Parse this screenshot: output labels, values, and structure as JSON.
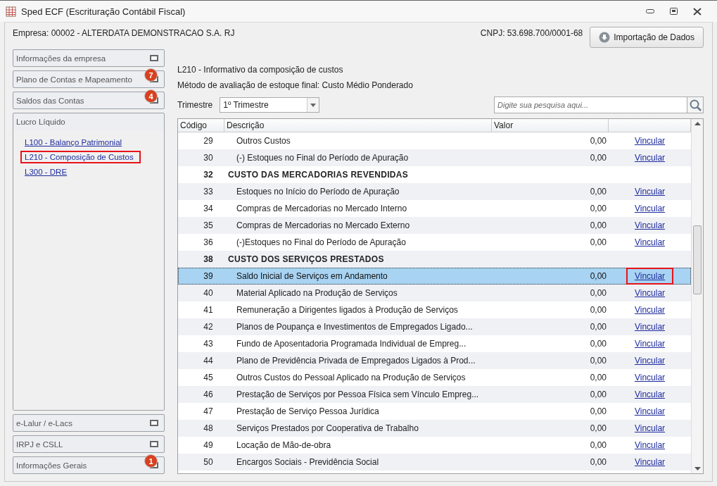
{
  "window": {
    "title": "Sped ECF (Escrituração Contábil Fiscal)"
  },
  "company": "Empresa: 00002 - ALTERDATA DEMONSTRACAO S.A. RJ",
  "cnpj": "CNPJ: 53.698.700/0001-68",
  "import_button": "Importação de Dados",
  "sidebar": {
    "top": [
      {
        "label": "Informações da empresa"
      },
      {
        "label": "Plano de Contas e Mapeamento",
        "badge": "7"
      },
      {
        "label": "Saldos das Contas",
        "badge": "4"
      }
    ],
    "open_section": {
      "label": "Lucro Líquido",
      "links": [
        {
          "label": "L100 - Balanço Patrimonial",
          "highlighted": false
        },
        {
          "label": "L210 - Composição de Custos",
          "highlighted": true
        },
        {
          "label": "L300 - DRE",
          "highlighted": false
        }
      ]
    },
    "bottom": [
      {
        "label": "e-Lalur / e-Lacs"
      },
      {
        "label": "IRPJ e CSLL"
      },
      {
        "label": "Informações Gerais",
        "badge": "1"
      }
    ]
  },
  "heading": "L210 - Informativo da composição de custos",
  "method": "Método de avaliação de estoque final: Custo Médio Ponderado",
  "trimestre": {
    "label": "Trimestre",
    "value": "1º Trimestre"
  },
  "search": {
    "placeholder": "Digite sua pesquisa aqui..."
  },
  "table": {
    "columns": [
      "Código",
      "Descrição",
      "Valor"
    ],
    "rows": [
      {
        "kind": "item",
        "code": "29",
        "description": "Outros Custos",
        "value": "0,00",
        "action": "Vincular",
        "selected": false,
        "highlighted": false
      },
      {
        "kind": "item",
        "code": "30",
        "description": "(-) Estoques no Final do Período de Apuração",
        "value": "0,00",
        "action": "Vincular",
        "selected": false,
        "highlighted": false
      },
      {
        "kind": "group",
        "code": "32",
        "description": "CUSTO DAS MERCADORIAS REVENDIDAS",
        "selected": false
      },
      {
        "kind": "item",
        "code": "33",
        "description": "Estoques no Início do Período de Apuração",
        "value": "0,00",
        "action": "Vincular",
        "selected": false,
        "highlighted": false
      },
      {
        "kind": "item",
        "code": "34",
        "description": "Compras de Mercadorias no Mercado Interno",
        "value": "0,00",
        "action": "Vincular",
        "selected": false,
        "highlighted": false
      },
      {
        "kind": "item",
        "code": "35",
        "description": "Compras de Mercadorias no Mercado Externo",
        "value": "0,00",
        "action": "Vincular",
        "selected": false,
        "highlighted": false
      },
      {
        "kind": "item",
        "code": "36",
        "description": "(-)Estoques no Final do Período de Apuração",
        "value": "0,00",
        "action": "Vincular",
        "selected": false,
        "highlighted": false
      },
      {
        "kind": "group",
        "code": "38",
        "description": "CUSTO DOS SERVIÇOS PRESTADOS",
        "selected": false
      },
      {
        "kind": "item",
        "code": "39",
        "description": "Saldo Inicial de Serviços em Andamento",
        "value": "0,00",
        "action": "Vincular",
        "selected": true,
        "highlighted": true
      },
      {
        "kind": "item",
        "code": "40",
        "description": "Material Aplicado na Produção de Serviços",
        "value": "0,00",
        "action": "Vincular",
        "selected": false,
        "highlighted": false
      },
      {
        "kind": "item",
        "code": "41",
        "description": "Remuneração a Dirigentes ligados à Produção de Serviços",
        "value": "0,00",
        "action": "Vincular",
        "selected": false,
        "highlighted": false
      },
      {
        "kind": "item",
        "code": "42",
        "description": "Planos de Poupança e Investimentos de Empregados Ligado...",
        "value": "0,00",
        "action": "Vincular",
        "selected": false,
        "highlighted": false
      },
      {
        "kind": "item",
        "code": "43",
        "description": "Fundo de Aposentadoria Programada Individual de Empreg...",
        "value": "0,00",
        "action": "Vincular",
        "selected": false,
        "highlighted": false
      },
      {
        "kind": "item",
        "code": "44",
        "description": "Plano de Previdência Privada de Empregados Ligados à Prod...",
        "value": "0,00",
        "action": "Vincular",
        "selected": false,
        "highlighted": false
      },
      {
        "kind": "item",
        "code": "45",
        "description": "Outros Custos do Pessoal Aplicado na Produção de Serviços",
        "value": "0,00",
        "action": "Vincular",
        "selected": false,
        "highlighted": false
      },
      {
        "kind": "item",
        "code": "46",
        "description": "Prestação de Serviços por Pessoa Física sem Vínculo Empreg...",
        "value": "0,00",
        "action": "Vincular",
        "selected": false,
        "highlighted": false
      },
      {
        "kind": "item",
        "code": "47",
        "description": "Prestação de Serviço Pessoa Jurídica",
        "value": "0,00",
        "action": "Vincular",
        "selected": false,
        "highlighted": false
      },
      {
        "kind": "item",
        "code": "48",
        "description": "Serviços Prestados por Cooperativa de Trabalho",
        "value": "0,00",
        "action": "Vincular",
        "selected": false,
        "highlighted": false
      },
      {
        "kind": "item",
        "code": "49",
        "description": "Locação de Mão-de-obra",
        "value": "0,00",
        "action": "Vincular",
        "selected": false,
        "highlighted": false
      },
      {
        "kind": "item",
        "code": "50",
        "description": "Encargos Sociais - Previdência Social",
        "value": "0,00",
        "action": "Vincular",
        "selected": false,
        "highlighted": false
      }
    ]
  }
}
